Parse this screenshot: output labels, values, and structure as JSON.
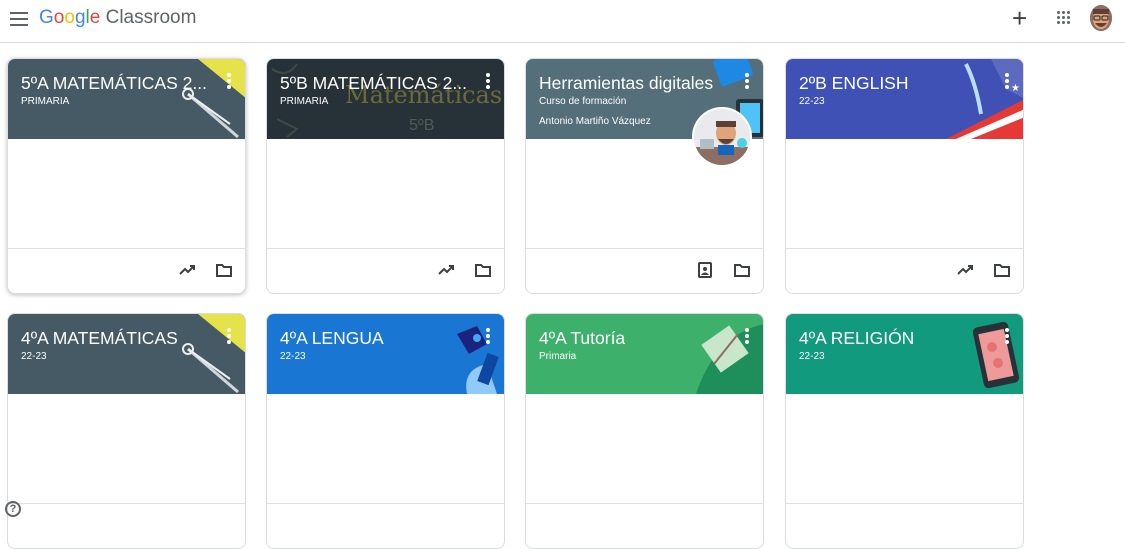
{
  "header": {
    "logo_google": [
      "G",
      "o",
      "o",
      "g",
      "l",
      "e"
    ],
    "logo_product": "Classroom"
  },
  "classes": [
    {
      "title": "5ºA MATEMÁTICAS 2...",
      "subtitle": "PRIMARIA",
      "teacher": "",
      "color": "#455a64",
      "foot_icons": [
        "trending-icon",
        "folder-icon"
      ]
    },
    {
      "title": "5ºB MATEMÁTICAS 2...",
      "subtitle": "PRIMARIA",
      "teacher": "",
      "color": "#263238",
      "banner_text": "Matemáticas",
      "banner_text2": "5ºB",
      "foot_icons": [
        "trending-icon",
        "folder-icon"
      ]
    },
    {
      "title": "Herramientas digitales",
      "subtitle": "Curso de formación",
      "teacher": "Antonio Martiño Vázquez",
      "color": "#546e7a",
      "foot_icons": [
        "portfolio-icon",
        "folder-icon"
      ]
    },
    {
      "title": "2ºB ENGLISH",
      "subtitle": "22-23",
      "teacher": "",
      "color": "#3f51b5",
      "foot_icons": [
        "trending-icon",
        "folder-icon"
      ]
    },
    {
      "title": "4ºA MATEMÁTICAS",
      "subtitle": "22-23",
      "teacher": "",
      "color": "#455a64"
    },
    {
      "title": "4ºA LENGUA",
      "subtitle": "22-23",
      "teacher": "",
      "color": "#1976d2"
    },
    {
      "title": "4ºA Tutoría",
      "subtitle": "Primaria",
      "teacher": "",
      "color": "#3db06b"
    },
    {
      "title": "4ºA RELIGIÓN",
      "subtitle": "22-23",
      "teacher": "",
      "color": "#129a7f"
    }
  ],
  "help": {
    "label": "?"
  }
}
